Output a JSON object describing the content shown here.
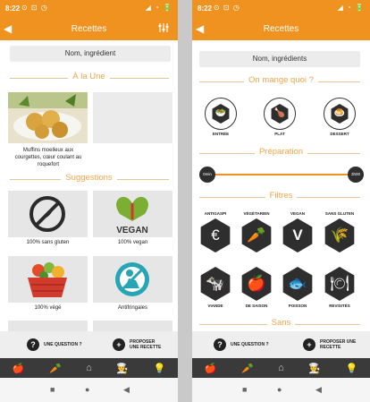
{
  "left": {
    "status": {
      "time": "8:22",
      "icons_left": "⊙ ⊡ ◷",
      "icons_right": "◢ ◔ 🔋"
    },
    "appbar": {
      "title": "Recettes"
    },
    "search": {
      "placeholder": "Nom, ingrédient"
    },
    "sections": {
      "une": "À la Une",
      "suggestions": "Suggestions"
    },
    "featured": {
      "caption": "Muffins moelleux aux courgettes, cœur coulant au roquefort"
    },
    "suggestions": [
      {
        "label": "100% sans gluten",
        "icon": "no-gluten-icon"
      },
      {
        "label": "100% vegan",
        "icon": "vegan-icon",
        "text": "VEGAN"
      },
      {
        "label": "100% végé",
        "icon": "vegetable-basket-icon"
      },
      {
        "label": "Antifringales",
        "icon": "antifringale-icon"
      }
    ],
    "actions": {
      "question": "UNE QUESTION ?",
      "propose": "PROPOSER UNE RECETTE"
    }
  },
  "right": {
    "status": {
      "time": "8:22",
      "icons_left": "⊙ ⊡ ◷",
      "icons_right": "◢ ◔ 🔋"
    },
    "appbar": {
      "title": "Recettes"
    },
    "search": {
      "placeholder": "Nom, ingrédients"
    },
    "sections": {
      "manger": "On mange quoi ?",
      "prep": "Préparation",
      "filtres": "Filtres",
      "sans": "Sans"
    },
    "meals": [
      {
        "label": "ENTRÉE",
        "icon": "salad-icon"
      },
      {
        "label": "PLAT",
        "icon": "chicken-icon"
      },
      {
        "label": "DESSERT",
        "icon": "pudding-icon"
      }
    ],
    "prep": {
      "min": "0min",
      "max": "3h00"
    },
    "filters_row1": [
      {
        "label": "ANTIGASPI",
        "icon": "euro-icon",
        "glyph": "€"
      },
      {
        "label": "VÉGÉTARIEN",
        "icon": "carrot-icon",
        "glyph": "🥕"
      },
      {
        "label": "VEGAN",
        "icon": "vegan-v-icon",
        "glyph": "V"
      },
      {
        "label": "SANS GLUTEN",
        "icon": "wheat-off-icon",
        "glyph": "🌾"
      }
    ],
    "filters_row2": [
      {
        "label": "VIANDE",
        "icon": "cow-icon",
        "glyph": "🐄"
      },
      {
        "label": "DE SAISON",
        "icon": "apple-icon",
        "glyph": "🍎"
      },
      {
        "label": "POISSON",
        "icon": "fish-icon",
        "glyph": "🐟"
      },
      {
        "label": "REVISITÉS",
        "icon": "cloche-icon",
        "glyph": "🍽"
      }
    ],
    "actions": {
      "question": "UNE QUESTION ?",
      "propose": "PROPOSER UNE RECETTE"
    }
  },
  "tabs": [
    "apple-icon",
    "carrot-icon",
    "home-icon",
    "chef-icon",
    "bulb-icon"
  ],
  "tab_glyphs": [
    "🍎",
    "🥕",
    "⌂",
    "👨‍🍳",
    "💡"
  ],
  "nav": [
    "■",
    "●",
    "◀"
  ]
}
